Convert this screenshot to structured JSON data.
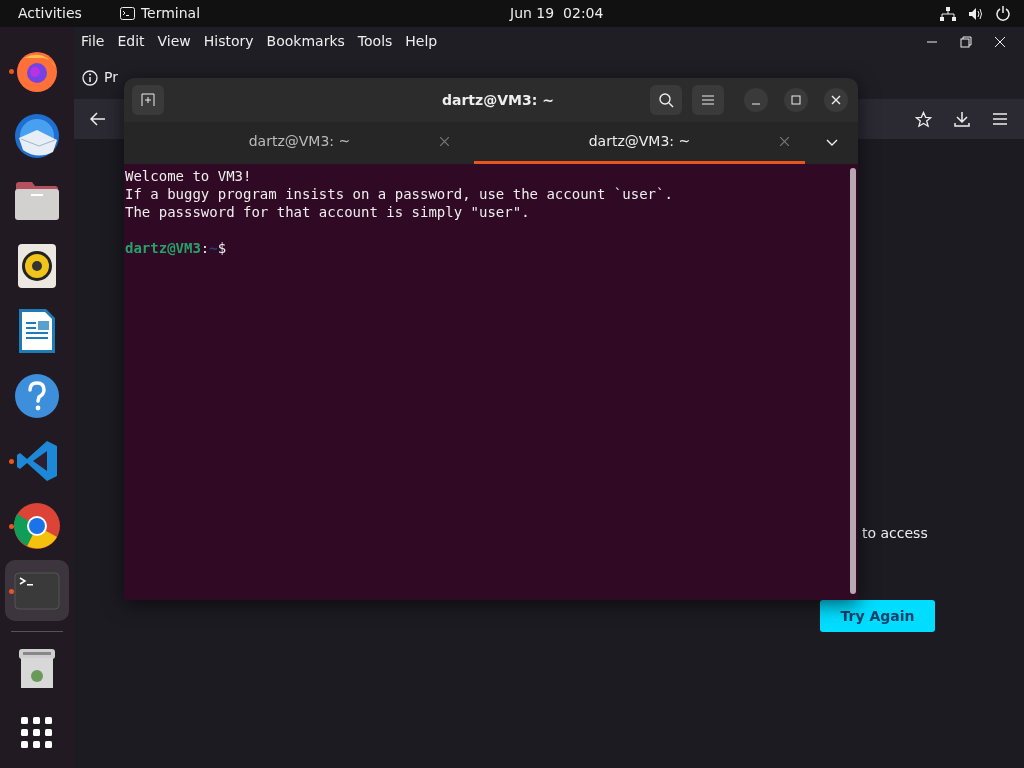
{
  "top_bar": {
    "activities": "Activities",
    "app_name": "Terminal",
    "clock": "Jun 19  02:04"
  },
  "dock": {
    "items": [
      {
        "kind": "firefox",
        "running": true,
        "selected": false
      },
      {
        "kind": "mail",
        "running": false,
        "selected": false
      },
      {
        "kind": "files",
        "running": false,
        "selected": false
      },
      {
        "kind": "speaker",
        "running": false,
        "selected": false
      },
      {
        "kind": "writer",
        "running": false,
        "selected": false
      },
      {
        "kind": "help",
        "running": false,
        "selected": false
      },
      {
        "kind": "code",
        "running": true,
        "selected": false
      },
      {
        "kind": "chrome",
        "running": true,
        "selected": false
      },
      {
        "kind": "terminal",
        "running": true,
        "selected": true
      },
      {
        "kind": "trash",
        "running": false,
        "selected": false
      },
      {
        "kind": "apps",
        "running": false,
        "selected": false
      }
    ]
  },
  "browser": {
    "menu": [
      "File",
      "Edit",
      "View",
      "History",
      "Bookmarks",
      "Tools",
      "Help"
    ],
    "tab_label": "Pr",
    "message": "to access",
    "button": "Try Again"
  },
  "terminal": {
    "title": "dartz@VM3: ~",
    "tabs": [
      {
        "label": "dartz@VM3: ~",
        "selected": false
      },
      {
        "label": "dartz@VM3: ~",
        "selected": true
      }
    ],
    "lines": [
      "Welcome to VM3!",
      "If a buggy program insists on a password, use the account `user`.",
      "The passsword for that account is simply \"user\"."
    ],
    "prompt": {
      "user_host": "dartz@VM3",
      "separator": ":",
      "path": "~",
      "symbol": "$"
    }
  }
}
